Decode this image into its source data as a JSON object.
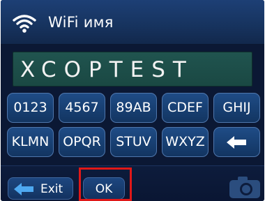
{
  "header": {
    "title": "WiFi имя",
    "icon": "wifi-icon"
  },
  "input": {
    "value": "XCOPTEST"
  },
  "keypad": {
    "keys": [
      {
        "label": "0123",
        "name": "key-0123"
      },
      {
        "label": "4567",
        "name": "key-4567"
      },
      {
        "label": "89AB",
        "name": "key-89ab"
      },
      {
        "label": "CDEF",
        "name": "key-cdef"
      },
      {
        "label": "GHIJ",
        "name": "key-ghij"
      },
      {
        "label": "KLMN",
        "name": "key-klmn"
      },
      {
        "label": "OPQR",
        "name": "key-opqr"
      },
      {
        "label": "STUV",
        "name": "key-stuv"
      },
      {
        "label": "WXYZ",
        "name": "key-wxyz"
      },
      {
        "label": "",
        "name": "key-backspace",
        "icon": "backspace-arrow-icon"
      }
    ]
  },
  "footer": {
    "exit_label": "Exit",
    "exit_icon": "back-arrow-icon",
    "ok_label": "OK",
    "camera_icon": "camera-icon"
  },
  "colors": {
    "background": "#0b1834",
    "key": "#173e70",
    "display": "#1d4e49",
    "highlight": "#e01818"
  }
}
